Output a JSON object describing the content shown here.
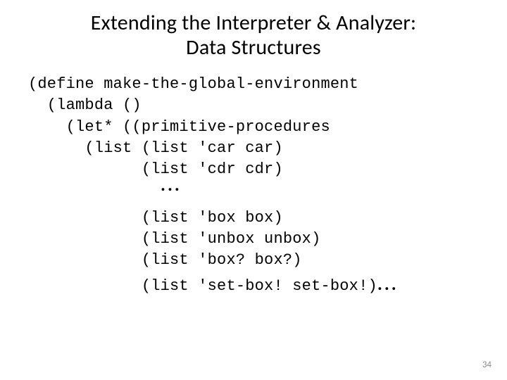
{
  "title_line1": "Extending the Interpreter & Analyzer:",
  "title_line2": "Data Structures",
  "code": {
    "l1": "(define make-the-global-environment",
    "l2": "  (lambda ()",
    "l3": "    (let* ((primitive-procedures",
    "l4": "      (list (list 'car car)",
    "l5": "            (list 'cdr cdr)",
    "dots1": "...",
    "l6": "            (list 'box box)",
    "l7": "            (list 'unbox unbox)",
    "l8": "            (list 'box? box?)",
    "l9a": "            (list 'set-box! set-box!)",
    "dots2": "..."
  },
  "page_number": "34"
}
